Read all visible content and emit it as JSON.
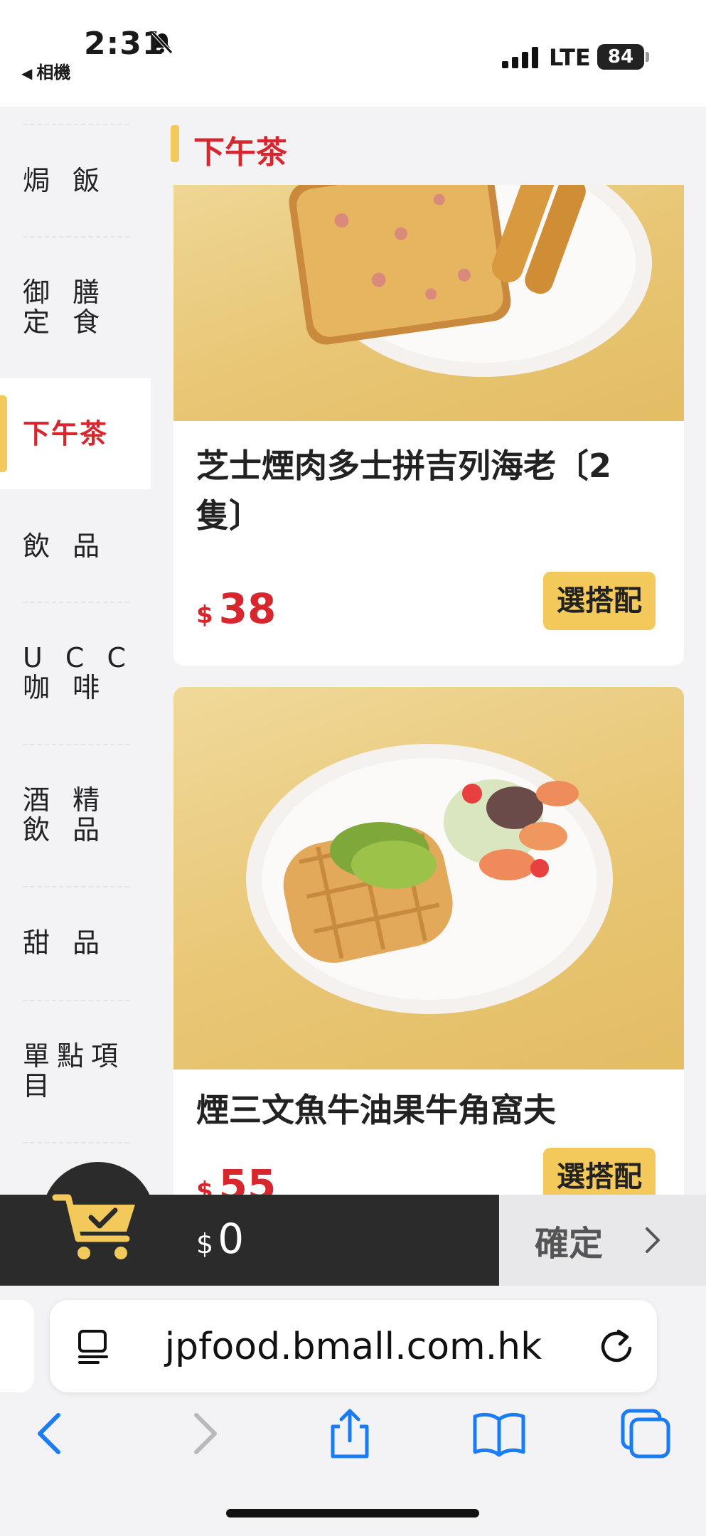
{
  "status_bar": {
    "time": "2:31",
    "back_label": "相機",
    "network": "LTE",
    "battery": "84"
  },
  "sidebar": {
    "items": [
      {
        "label": "焗 飯",
        "active": false
      },
      {
        "label": "御 膳\n定 食",
        "active": false
      },
      {
        "label": "下午茶",
        "active": true
      },
      {
        "label": "飲 品",
        "active": false
      },
      {
        "label": "U C C\n  咖 啡",
        "active": false
      },
      {
        "label": "酒 精\n飲 品",
        "active": false
      },
      {
        "label": "甜 品",
        "active": false
      },
      {
        "label": "單點項\n目",
        "active": false
      }
    ]
  },
  "section": {
    "title": "下午茶"
  },
  "products": [
    {
      "name": "芝士煙肉多士拼吉列海老〔2隻〕",
      "currency": "$",
      "price": "38",
      "button": "選搭配"
    },
    {
      "name": "煙三文魚牛油果牛角窩夫",
      "currency": "$",
      "price": "55",
      "button": "選搭配"
    }
  ],
  "cart": {
    "currency": "$",
    "total": "0",
    "confirm_label": "確定"
  },
  "browser": {
    "url": "jpfood.bmall.com.hk"
  },
  "colors": {
    "accent_red": "#d7262e",
    "accent_yellow": "#f2c95a",
    "cart_bar": "#2b2b2b",
    "ios_blue": "#1a7cf2"
  }
}
